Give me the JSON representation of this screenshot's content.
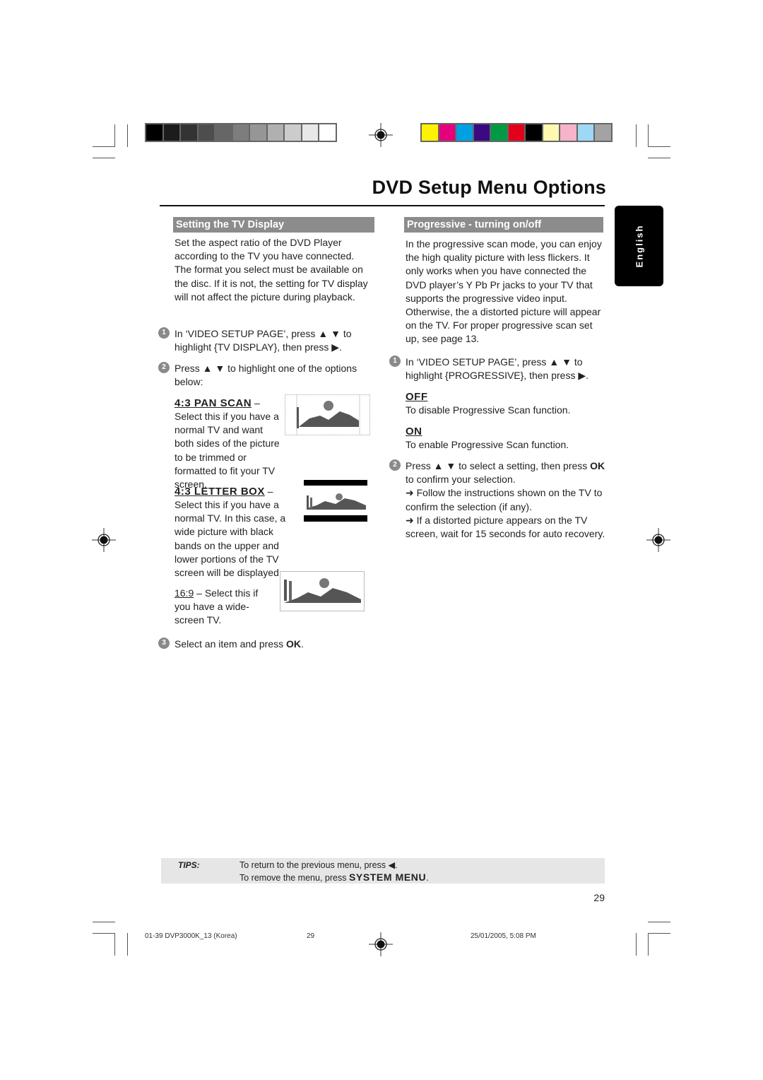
{
  "print_marks": {
    "gray_swatches": [
      "#000000",
      "#1c1c1c",
      "#333333",
      "#4d4d4d",
      "#666666",
      "#7d7d7d",
      "#969696",
      "#b0b0b0",
      "#cccccc",
      "#e8e8e8",
      "#ffffff"
    ],
    "color_swatches": [
      "#fff200",
      "#e6007e",
      "#00a0e3",
      "#3b0a80",
      "#009a44",
      "#e2001a",
      "#000000",
      "#fff8b0",
      "#f6b3ca",
      "#9fd8f4",
      "#a3a3a3"
    ]
  },
  "header": {
    "title": "DVD Setup Menu Options",
    "language_tab": "English"
  },
  "left": {
    "section_title": "Setting the TV Display",
    "intro": "Set the aspect ratio of the DVD Player according to the TV you have connected. The format you select must be available on the disc.  If it is not, the setting for TV display will not affect the picture during playback.",
    "steps": [
      {
        "num": "1",
        "text_before": "In ‘VIDEO SETUP PAGE’, press ▲ ▼ to highlight {TV DISPLAY}, then press ▶."
      },
      {
        "num": "2",
        "text_before": "Press ▲ ▼ to highlight one of the options below:"
      },
      {
        "num": "3",
        "text_before": "Select an item and press ",
        "bold": "OK",
        "text_after": "."
      }
    ],
    "options": [
      {
        "name": "4:3 PAN SCAN",
        "dash": " –",
        "desc": "Select this if you have a normal TV and want both sides of the picture to be trimmed or formatted to fit your TV screen.",
        "image": "pan-scan-landscape-image"
      },
      {
        "name": "4:3 LETTER BOX",
        "dash": " –",
        "desc": "Select this if you have a normal TV. In this case, a wide picture with black bands on the upper and lower portions of the TV screen will be displayed.",
        "image": "letterbox-landscape-image"
      },
      {
        "name": "16:9",
        "dash": " – Select this if you have a wide-screen TV.",
        "desc": "",
        "image": "widescreen-landscape-image"
      }
    ]
  },
  "right": {
    "section_title": "Progressive - turning on/off",
    "intro": "In the progressive scan mode, you can enjoy the high quality picture with less flickers.  It only works when you have connected the DVD player’s Y Pb Pr jacks to your TV that supports the progressive video input.  Otherwise, the a distorted picture will appear on the TV.  For proper progressive scan set up, see page 13.",
    "steps": [
      {
        "num": "1",
        "text": "In ‘VIDEO SETUP PAGE’, press ▲ ▼ to highlight {PROGRESSIVE}, then press ▶."
      },
      {
        "num": "2",
        "text_before": "Press ▲ ▼ to select a setting, then press ",
        "bold": "OK",
        "text_after": " to confirm your selection.",
        "notes": [
          "➜ Follow the instructions shown on the TV to confirm the selection (if any).",
          "➜ If a distorted picture appears on the TV screen, wait for 15 seconds for auto recovery."
        ]
      }
    ],
    "options": [
      {
        "name": "OFF",
        "desc": "To disable Progressive Scan function."
      },
      {
        "name": "ON",
        "desc": "To enable Progressive Scan function."
      }
    ]
  },
  "tips": {
    "label": "TIPS:",
    "line1": "To return to the previous menu, press ◀.",
    "line2_before": "To remove the menu, press ",
    "line2_bold": "SYSTEM MENU",
    "line2_after": "."
  },
  "page_number": "29",
  "footer": {
    "file": "01-39 DVP3000K_13 (Korea)",
    "page": "29",
    "timestamp": "25/01/2005, 5:08 PM"
  }
}
